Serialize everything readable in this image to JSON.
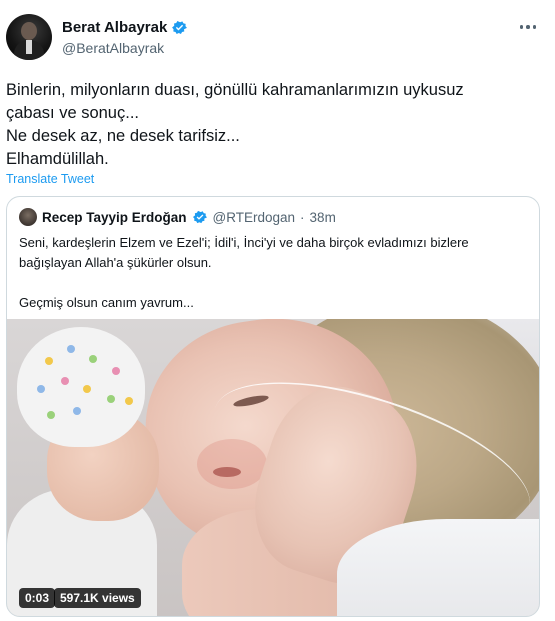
{
  "author": {
    "name": "Berat Albayrak",
    "handle": "@BeratAlbayrak",
    "verified": true
  },
  "tweet": {
    "lines": [
      "Binlerin, milyonların duası, gönüllü kahramanlarımızın uykusuz",
      "çabası ve sonuç...",
      "Ne desek az, ne desek tarifsiz...",
      "Elhamdülillah."
    ],
    "translate_label": "Translate Tweet"
  },
  "quoted": {
    "name": "Recep Tayyip Erdoğan",
    "handle": "@RTErdogan",
    "separator": "·",
    "time": "38m",
    "verified": true,
    "lines": [
      "Seni, kardeşlerin Elzem ve Ezel'i; İdil'i, İnci'yi ve daha birçok evladımızı bizlere",
      "bağışlayan Allah'a şükürler olsun."
    ],
    "line2": "Geçmiş olsun canım yavrum...",
    "video": {
      "elapsed": "0:03",
      "views": "597.1K views"
    }
  },
  "colors": {
    "accent": "#1d9bf0",
    "text": "#0f1419",
    "secondary": "#536471",
    "border": "#cfd9de"
  },
  "icons": {
    "verified": "verified-badge-icon",
    "more": "more-options-icon"
  }
}
